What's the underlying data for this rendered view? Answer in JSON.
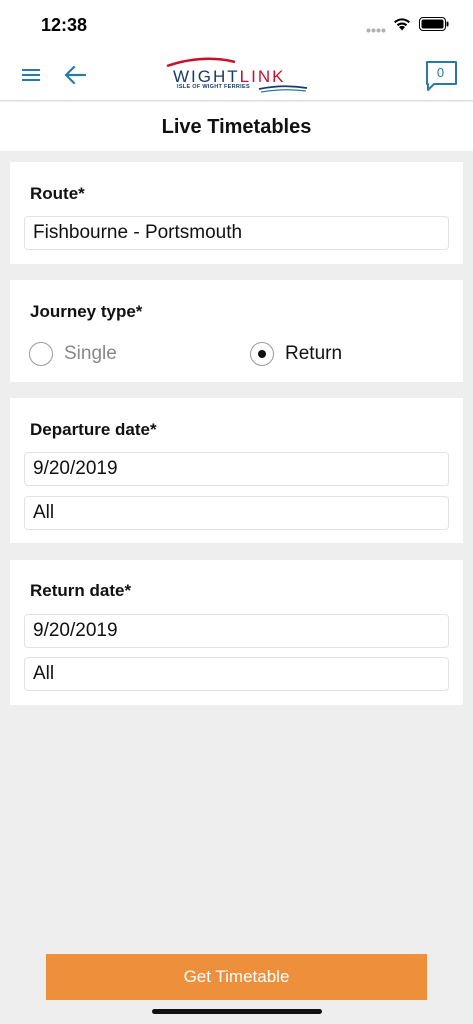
{
  "status": {
    "time": "12:38"
  },
  "header": {
    "logo": {
      "part1": "WIGHT",
      "part2": "LINK",
      "subtitle": "ISLE OF WIGHT FERRIES"
    },
    "chat_count": "0"
  },
  "page": {
    "title": "Live Timetables"
  },
  "route": {
    "label": "Route*",
    "value": "Fishbourne - Portsmouth"
  },
  "journey": {
    "label": "Journey type*",
    "options": [
      {
        "label": "Single",
        "selected": false
      },
      {
        "label": "Return",
        "selected": true
      }
    ]
  },
  "departure": {
    "label": "Departure date*",
    "date": "9/20/2019",
    "time": "All"
  },
  "return_trip": {
    "label": "Return date*",
    "date": "9/20/2019",
    "time": "All"
  },
  "actions": {
    "get_timetable": "Get Timetable"
  },
  "colors": {
    "accent": "#ee8f3c",
    "brand_blue": "#1b3a6b",
    "brand_red": "#c8102e",
    "icon_blue": "#2a7aa8"
  }
}
